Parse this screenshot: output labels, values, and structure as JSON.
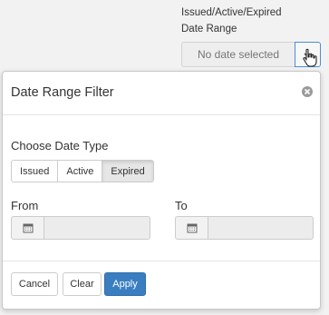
{
  "header": {
    "column_label": "Issued/Active/Expired",
    "range_label": "Date Range",
    "range_placeholder": "No date selected"
  },
  "popover": {
    "title": "Date Range Filter",
    "close_icon": "close-circle-icon",
    "date_type_label": "Choose Date Type",
    "date_types": [
      "Issued",
      "Active",
      "Expired"
    ],
    "selected_date_type": "Expired",
    "from_label": "From",
    "to_label": "To",
    "from_value": "",
    "to_value": "",
    "calendar_icon": "calendar-icon",
    "buttons": {
      "cancel": "Cancel",
      "clear": "Clear",
      "apply": "Apply"
    }
  },
  "colors": {
    "primary": "#3a7ec2",
    "focus_border": "#4a8ed6",
    "page_bg": "#f2f2f2"
  }
}
